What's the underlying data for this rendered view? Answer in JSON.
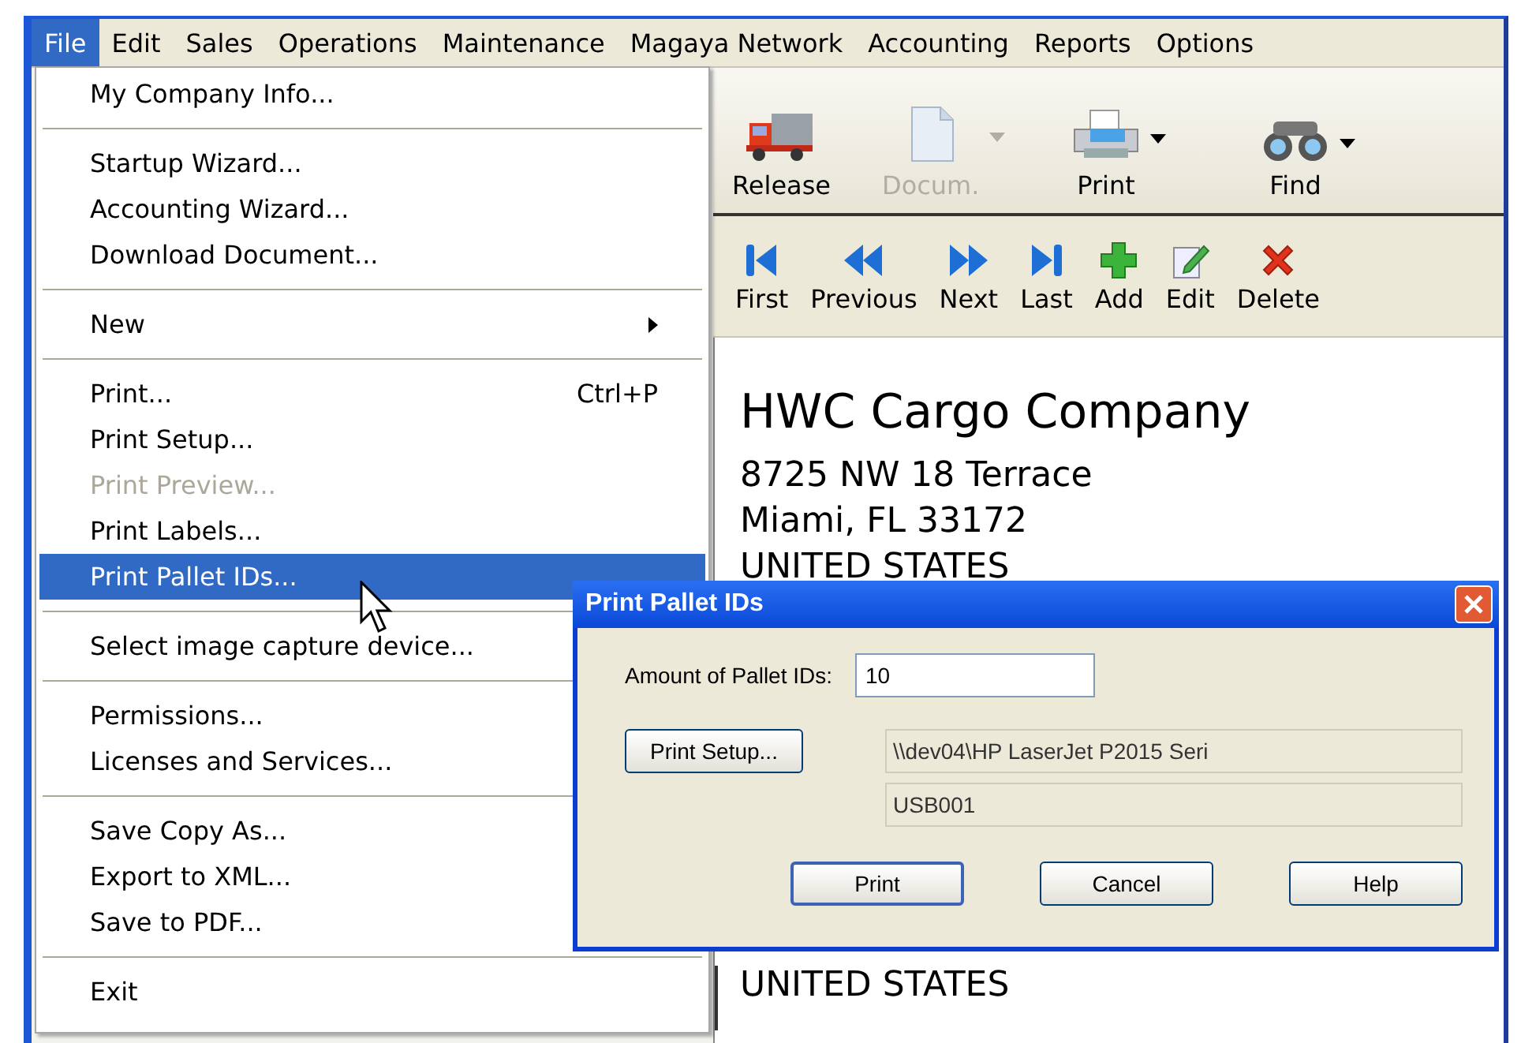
{
  "menubar": [
    {
      "label": "File",
      "selected": true
    },
    {
      "label": "Edit",
      "selected": false
    },
    {
      "label": "Sales",
      "selected": false
    },
    {
      "label": "Operations",
      "selected": false
    },
    {
      "label": "Maintenance",
      "selected": false
    },
    {
      "label": "Magaya Network",
      "selected": false
    },
    {
      "label": "Accounting",
      "selected": false
    },
    {
      "label": "Reports",
      "selected": false
    },
    {
      "label": "Options",
      "selected": false
    }
  ],
  "file_menu": [
    [
      {
        "label": "My Company Info...",
        "kind": "plain",
        "disabled": false,
        "selected": false
      }
    ],
    [
      {
        "label": "Startup Wizard...",
        "kind": "plain",
        "disabled": false,
        "selected": false
      },
      {
        "label": "Accounting Wizard...",
        "kind": "plain",
        "disabled": false,
        "selected": false
      },
      {
        "label": "Download Document...",
        "kind": "plain",
        "disabled": false,
        "selected": false
      }
    ],
    [
      {
        "label": "New",
        "kind": "submenu",
        "disabled": false,
        "selected": false
      }
    ],
    [
      {
        "label": "Print...",
        "shortcut": "Ctrl+P",
        "kind": "plain",
        "disabled": false,
        "selected": false
      },
      {
        "label": "Print Setup...",
        "kind": "plain",
        "disabled": false,
        "selected": false
      },
      {
        "label": "Print Preview...",
        "kind": "plain",
        "disabled": true,
        "selected": false
      },
      {
        "label": "Print Labels...",
        "kind": "plain",
        "disabled": false,
        "selected": false
      },
      {
        "label": "Print Pallet IDs...",
        "kind": "plain",
        "disabled": false,
        "selected": true
      }
    ],
    [
      {
        "label": "Select image capture device...",
        "kind": "plain",
        "disabled": false,
        "selected": false
      }
    ],
    [
      {
        "label": "Permissions...",
        "kind": "plain",
        "disabled": false,
        "selected": false
      },
      {
        "label": "Licenses and Services...",
        "kind": "plain",
        "disabled": false,
        "selected": false
      }
    ],
    [
      {
        "label": "Save Copy As...",
        "kind": "plain",
        "disabled": false,
        "selected": false
      },
      {
        "label": "Export to XML...",
        "kind": "plain",
        "disabled": false,
        "selected": false
      },
      {
        "label": "Save to PDF...",
        "kind": "plain",
        "disabled": false,
        "selected": false
      }
    ],
    [
      {
        "label": "Exit",
        "kind": "plain",
        "disabled": false,
        "selected": false
      }
    ]
  ],
  "toolbar": [
    {
      "label": "Release",
      "disabled": false,
      "dropdown": false
    },
    {
      "label": "Docum.",
      "disabled": true,
      "dropdown": true
    },
    {
      "label": "Print",
      "disabled": false,
      "dropdown": true
    },
    {
      "label": "Find",
      "disabled": false,
      "dropdown": true
    }
  ],
  "navigation": [
    {
      "label": "First"
    },
    {
      "label": "Previous"
    },
    {
      "label": "Next"
    },
    {
      "label": "Last"
    },
    {
      "label": "Add"
    },
    {
      "label": "Edit"
    },
    {
      "label": "Delete"
    }
  ],
  "document": {
    "company": "HWC Cargo Company",
    "address": [
      "8725 NW 18 Terrace",
      "Miami, FL 33172",
      "UNITED STATES"
    ],
    "footer_line": "UNITED STATES"
  },
  "dialog": {
    "title": "Print Pallet IDs",
    "amount_label": "Amount of Pallet IDs:",
    "amount_value": "10",
    "setup_button": "Print Setup...",
    "printer": "\\\\dev04\\HP LaserJet P2015 Seri",
    "port": "USB001",
    "buttons": [
      {
        "label": "Print",
        "default": true
      },
      {
        "label": "Cancel",
        "default": false
      },
      {
        "label": "Help",
        "default": false
      }
    ]
  }
}
